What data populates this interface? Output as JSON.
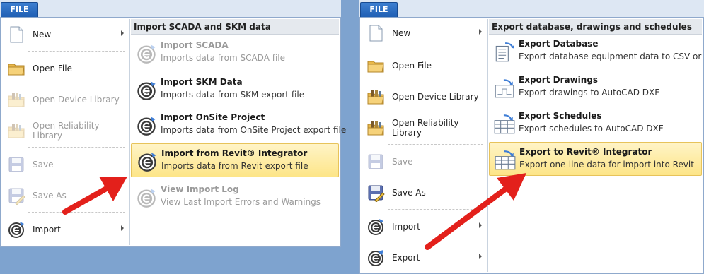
{
  "left_panel": {
    "file_tab": "FILE",
    "menu": {
      "new": "New",
      "open_file": "Open File",
      "open_device_library": "Open Device Library",
      "open_reliability_library": "Open Reliability Library",
      "save": "Save",
      "save_as": "Save As",
      "import": "Import"
    },
    "submenu": {
      "header": "Import SCADA and SKM data",
      "items": [
        {
          "title": "Import SCADA",
          "desc": "Imports data from SCADA file"
        },
        {
          "title": "Import SKM Data",
          "desc": "Imports data from SKM export file"
        },
        {
          "title": "Import OnSite Project",
          "desc": "Imports data from OnSite Project export file"
        },
        {
          "title": "Import from Revit® Integrator",
          "desc": "Imports data from Revit export file"
        },
        {
          "title": "View Import Log",
          "desc": "View Last Import Errors and Warnings"
        }
      ]
    }
  },
  "right_panel": {
    "file_tab": "FILE",
    "menu": {
      "new": "New",
      "open_file": "Open File",
      "open_device_library": "Open Device Library",
      "open_reliability_library": "Open Reliability Library",
      "save": "Save",
      "save_as": "Save As",
      "import": "Import",
      "export": "Export"
    },
    "submenu": {
      "header": "Export database, drawings and schedules",
      "items": [
        {
          "title": "Export Database",
          "desc": "Export database equipment data to CSV or Excel"
        },
        {
          "title": "Export Drawings",
          "desc": "Export drawings to AutoCAD DXF"
        },
        {
          "title": "Export Schedules",
          "desc": "Export schedules to AutoCAD DXF"
        },
        {
          "title": "Export to Revit® Integrator",
          "desc": "Export one-line data for import into Revit"
        }
      ]
    }
  },
  "colors": {
    "accent_tab": "#1f5fb4",
    "highlight": "#fde588",
    "arrow": "#e3201b",
    "background": "#7ea3cf"
  }
}
